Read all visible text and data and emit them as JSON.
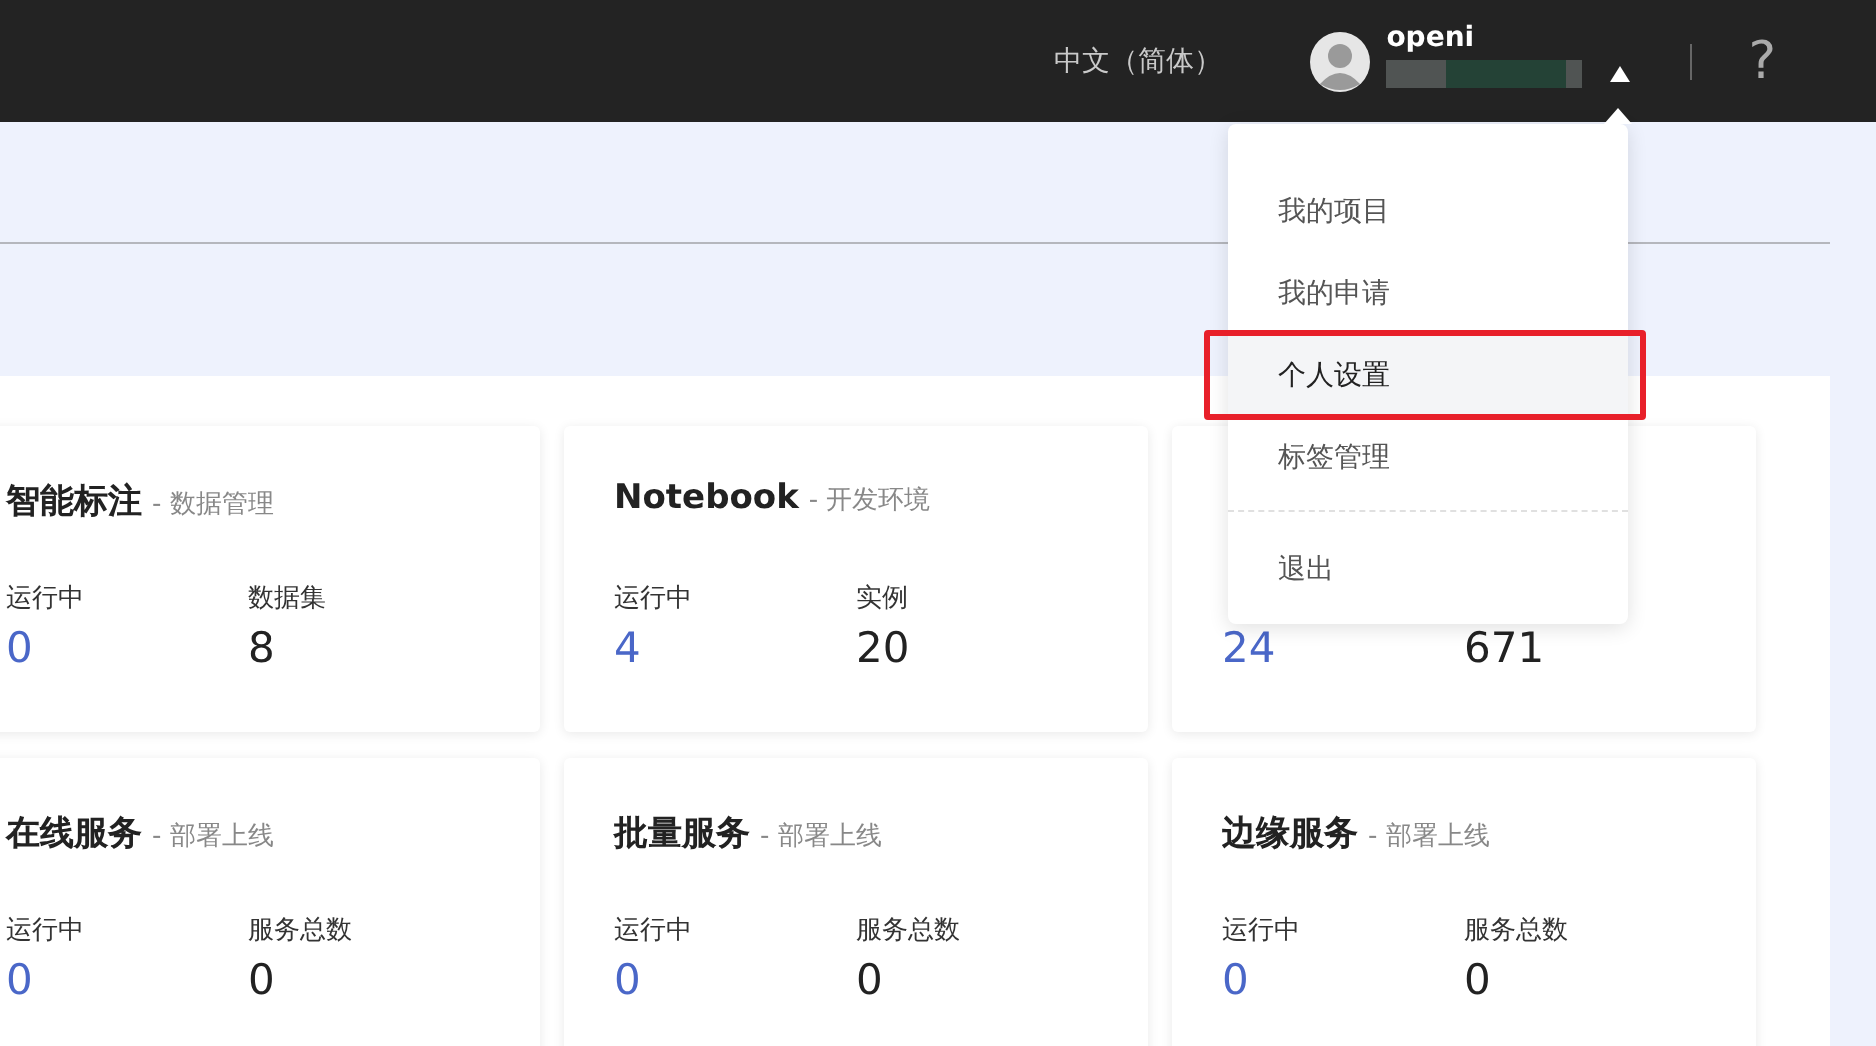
{
  "topbar": {
    "language": "中文（简体）",
    "user": {
      "name": "openi"
    },
    "help": "?"
  },
  "user_menu": {
    "items": [
      {
        "label": "我的项目",
        "selected": false,
        "divider_before": false
      },
      {
        "label": "我的申请",
        "selected": false,
        "divider_before": false
      },
      {
        "label": "个人设置",
        "selected": true,
        "divider_before": false
      },
      {
        "label": "标签管理",
        "selected": false,
        "divider_before": false
      },
      {
        "label": "退出",
        "selected": false,
        "divider_before": true
      }
    ]
  },
  "cards": [
    {
      "title": "智能标注",
      "subtitle": "- 数据管理",
      "stats": [
        {
          "label": "运行中",
          "value": "0",
          "kind": "running"
        },
        {
          "label": "数据集",
          "value": "8",
          "kind": "total"
        }
      ]
    },
    {
      "title": "Notebook",
      "subtitle": "- 开发环境",
      "stats": [
        {
          "label": "运行中",
          "value": "4",
          "kind": "running"
        },
        {
          "label": "实例",
          "value": "20",
          "kind": "total"
        }
      ]
    },
    {
      "stats": [
        {
          "value": "24",
          "kind": "running"
        },
        {
          "value": "671",
          "kind": "total"
        }
      ]
    },
    {
      "title": "在线服务",
      "subtitle": "- 部署上线",
      "stats": [
        {
          "label": "运行中",
          "value": "0",
          "kind": "running"
        },
        {
          "label": "服务总数",
          "value": "0",
          "kind": "total"
        }
      ]
    },
    {
      "title": "批量服务",
      "subtitle": "- 部署上线",
      "stats": [
        {
          "label": "运行中",
          "value": "0",
          "kind": "running"
        },
        {
          "label": "服务总数",
          "value": "0",
          "kind": "total"
        }
      ]
    },
    {
      "title": "边缘服务",
      "subtitle": "- 部署上线",
      "stats": [
        {
          "label": "运行中",
          "value": "0",
          "kind": "running"
        },
        {
          "label": "服务总数",
          "value": "0",
          "kind": "total"
        }
      ]
    }
  ]
}
